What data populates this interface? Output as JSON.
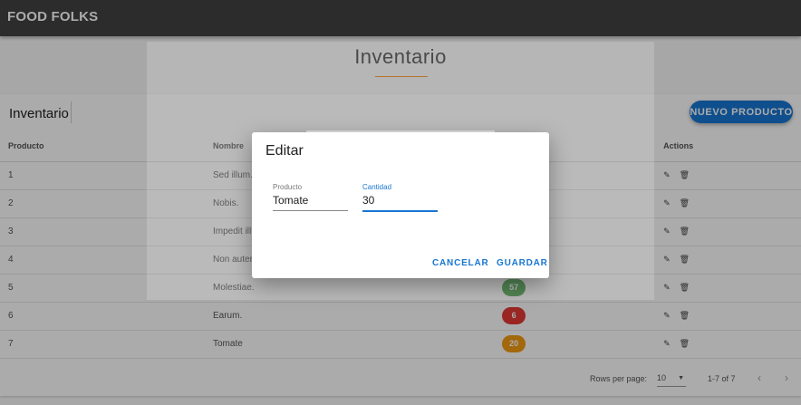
{
  "app": {
    "brand": "FOOD FOLKS"
  },
  "page": {
    "title": "Inventario"
  },
  "card": {
    "title": "Inventario",
    "new_button": "NUEVO PRODUCTO"
  },
  "table": {
    "headers": [
      "Producto",
      "Nombre",
      "",
      "Actions"
    ],
    "rows": [
      {
        "id": "1",
        "name": "Sed illum.",
        "qty": "",
        "color": ""
      },
      {
        "id": "2",
        "name": "Nobis.",
        "qty": "",
        "color": ""
      },
      {
        "id": "3",
        "name": "Impedit illum.",
        "qty": "",
        "color": ""
      },
      {
        "id": "4",
        "name": "Non autem.",
        "qty": "",
        "color": ""
      },
      {
        "id": "5",
        "name": "Molestiae.",
        "qty": "57",
        "color": "#43a047"
      },
      {
        "id": "6",
        "name": "Earum.",
        "qty": "6",
        "color": "#e53935"
      },
      {
        "id": "7",
        "name": "Tomate",
        "qty": "20",
        "color": "#f39c12"
      }
    ]
  },
  "footer": {
    "rows_per_page_label": "Rows per page:",
    "rows_per_page_value": "10",
    "range": "1-7 of 7"
  },
  "dialog": {
    "title": "Editar",
    "producto_label": "Producto",
    "producto_value": "Tomate",
    "cantidad_label": "Cantidad",
    "cantidad_value": "30",
    "cancel": "CANCELAR",
    "save": "GUARDAR"
  },
  "icons": {
    "edit": "pencil-icon",
    "delete": "trash-icon",
    "caret": "caret-down-icon",
    "prev": "chevron-left-icon",
    "next": "chevron-right-icon"
  }
}
